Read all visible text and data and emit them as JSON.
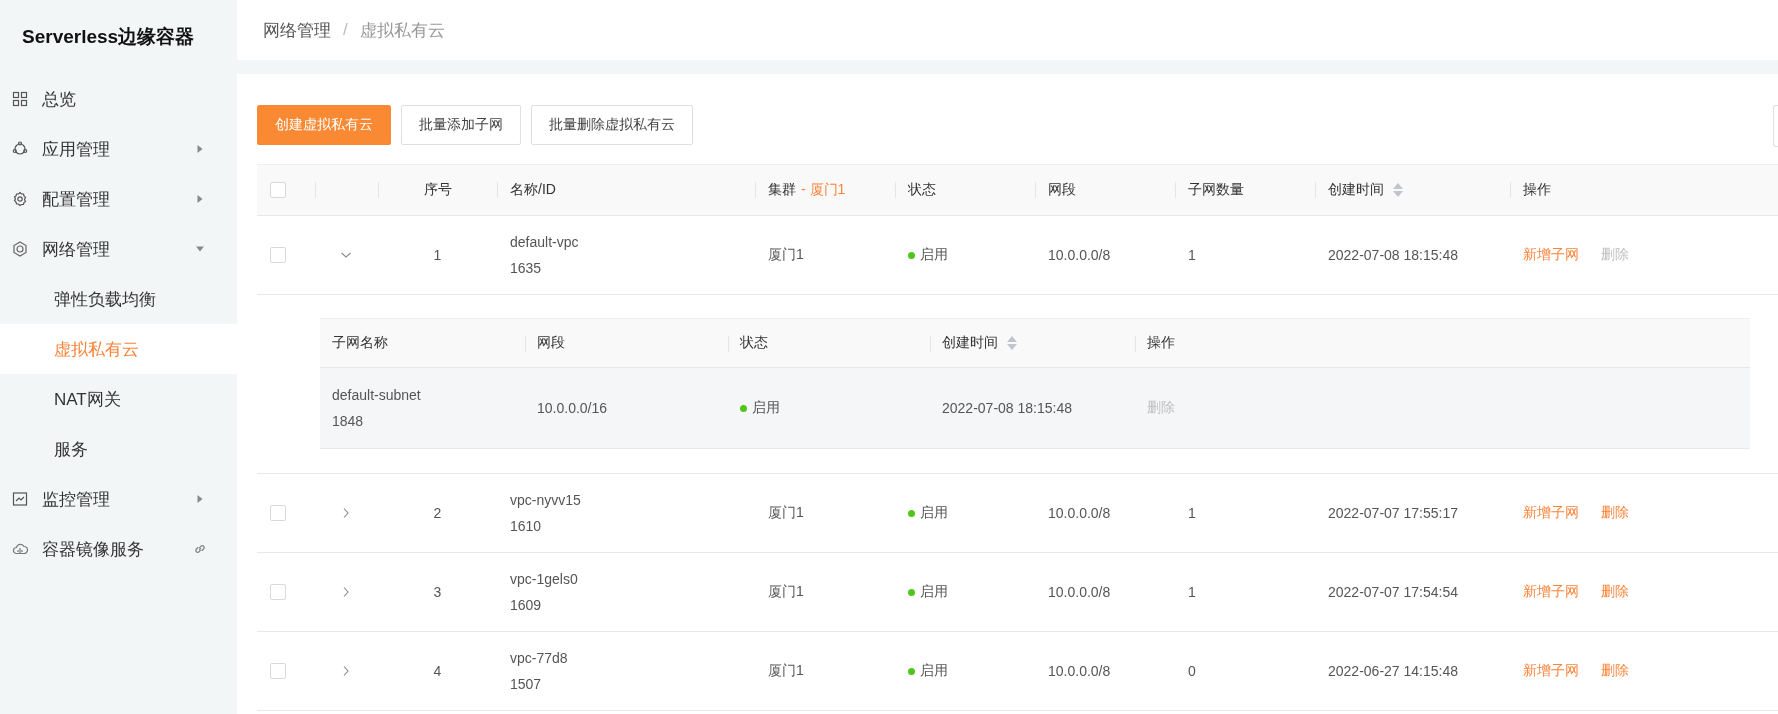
{
  "sidebar": {
    "title": "Serverless边缘容器",
    "items": [
      {
        "label": "总览",
        "kind": "page"
      },
      {
        "label": "应用管理",
        "kind": "group",
        "expanded": false
      },
      {
        "label": "配置管理",
        "kind": "group",
        "expanded": false
      },
      {
        "label": "网络管理",
        "kind": "group",
        "expanded": true,
        "children": [
          {
            "label": "弹性负载均衡",
            "selected": false
          },
          {
            "label": "虚拟私有云",
            "selected": true
          },
          {
            "label": "NAT网关",
            "selected": false
          },
          {
            "label": "服务",
            "selected": false
          }
        ]
      },
      {
        "label": "监控管理",
        "kind": "group",
        "expanded": false
      },
      {
        "label": "容器镜像服务",
        "kind": "link"
      }
    ]
  },
  "breadcrumb": [
    "网络管理",
    "/",
    "虚拟私有云"
  ],
  "toolbar": {
    "buttons": [
      {
        "label": "创建虚拟私有云",
        "primary": true
      },
      {
        "label": "批量添加子网",
        "primary": false
      },
      {
        "label": "批量删除虚拟私有云",
        "primary": false
      }
    ]
  },
  "table": {
    "select_all_checked": false,
    "columns": [
      {
        "label": "序号"
      },
      {
        "label": "名称/ID"
      },
      {
        "label": "集群",
        "filter": "- 厦门1"
      },
      {
        "label": "状态"
      },
      {
        "label": "网段"
      },
      {
        "label": "子网数量"
      },
      {
        "label": "创建时间",
        "sortable": true
      },
      {
        "label": "操作"
      }
    ],
    "rows": [
      {
        "checked": false,
        "expanded": true,
        "index": "1",
        "name": "default-vpc",
        "id": "1635",
        "cluster": "厦门1",
        "status": "启用",
        "cidr": "10.0.0.0/8",
        "subnets": "1",
        "created": "2022-07-08 18:15:48",
        "actions": [
          {
            "label": "新增子网",
            "disabled": false
          },
          {
            "label": "删除",
            "disabled": true
          }
        ],
        "subtable": {
          "columns": [
            {
              "label": "子网名称"
            },
            {
              "label": "网段"
            },
            {
              "label": "状态"
            },
            {
              "label": "创建时间",
              "sortable": true
            },
            {
              "label": "操作"
            }
          ],
          "rows": [
            {
              "name": "default-subnet",
              "id": "1848",
              "cidr": "10.0.0.0/16",
              "status": "启用",
              "created": "2022-07-08 18:15:48",
              "actions": [
                {
                  "label": "删除",
                  "disabled": true
                }
              ]
            }
          ]
        }
      },
      {
        "checked": false,
        "expanded": false,
        "index": "2",
        "name": "vpc-nyvv15",
        "id": "1610",
        "cluster": "厦门1",
        "status": "启用",
        "cidr": "10.0.0.0/8",
        "subnets": "1",
        "created": "2022-07-07 17:55:17",
        "actions": [
          {
            "label": "新增子网",
            "disabled": false
          },
          {
            "label": "删除",
            "disabled": false
          }
        ]
      },
      {
        "checked": false,
        "expanded": false,
        "index": "3",
        "name": "vpc-1gels0",
        "id": "1609",
        "cluster": "厦门1",
        "status": "启用",
        "cidr": "10.0.0.0/8",
        "subnets": "1",
        "created": "2022-07-07 17:54:54",
        "actions": [
          {
            "label": "新增子网",
            "disabled": false
          },
          {
            "label": "删除",
            "disabled": false
          }
        ]
      },
      {
        "checked": false,
        "expanded": false,
        "index": "4",
        "name": "vpc-77d8",
        "id": "1507",
        "cluster": "厦门1",
        "status": "启用",
        "cidr": "10.0.0.0/8",
        "subnets": "0",
        "created": "2022-06-27 14:15:48",
        "actions": [
          {
            "label": "新增子网",
            "disabled": false
          },
          {
            "label": "删除",
            "disabled": false
          }
        ]
      }
    ]
  }
}
